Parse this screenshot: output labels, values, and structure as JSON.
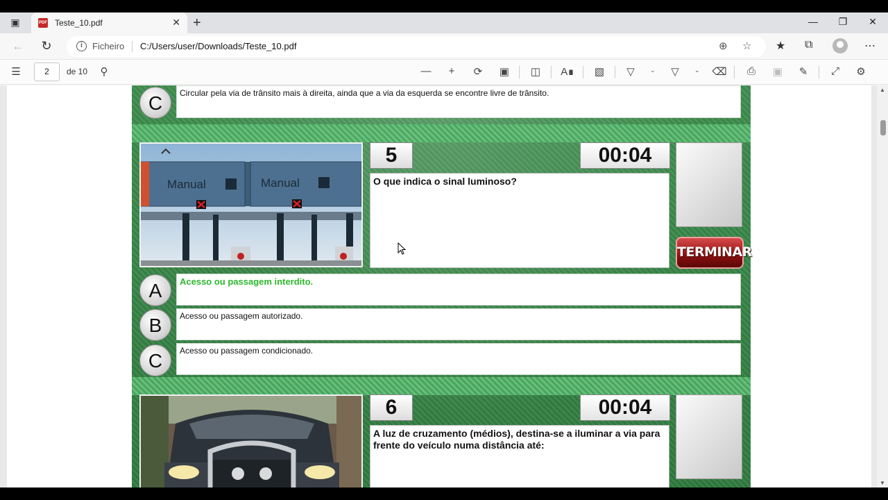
{
  "browser": {
    "tab_title": "Teste_10.pdf",
    "site_label": "Ficheiro",
    "url": "C:/Users/user/Downloads/Teste_10.pdf"
  },
  "pdf_toolbar": {
    "page_number": "2",
    "page_total": "de 10"
  },
  "quiz": {
    "prev_answer_c": {
      "letter": "C",
      "text": "Circular pela via de trânsito mais à direita, ainda que a via da esquerda se encontre livre de trânsito."
    },
    "question5": {
      "number": "5",
      "timer": "00:04",
      "question": "O que indica o sinal luminoso?",
      "photo_labels": [
        "Manual",
        "Manual"
      ],
      "answers": [
        {
          "letter": "A",
          "text": "Acesso ou passagem interdito.",
          "correct": true
        },
        {
          "letter": "B",
          "text": "Acesso ou passagem autorizado.",
          "correct": false
        },
        {
          "letter": "C",
          "text": "Acesso ou passagem condicionado.",
          "correct": false
        }
      ],
      "finish_button": "TERMINAR"
    },
    "question6": {
      "number": "6",
      "timer": "00:04",
      "question": "A luz de cruzamento (médios), destina-se a iluminar a via para frente do veículo numa distância até:"
    }
  },
  "colors": {
    "quiz_green": "#2f7a3e",
    "correct_answer": "#2eb82e",
    "terminar_red": "#8a1010"
  }
}
